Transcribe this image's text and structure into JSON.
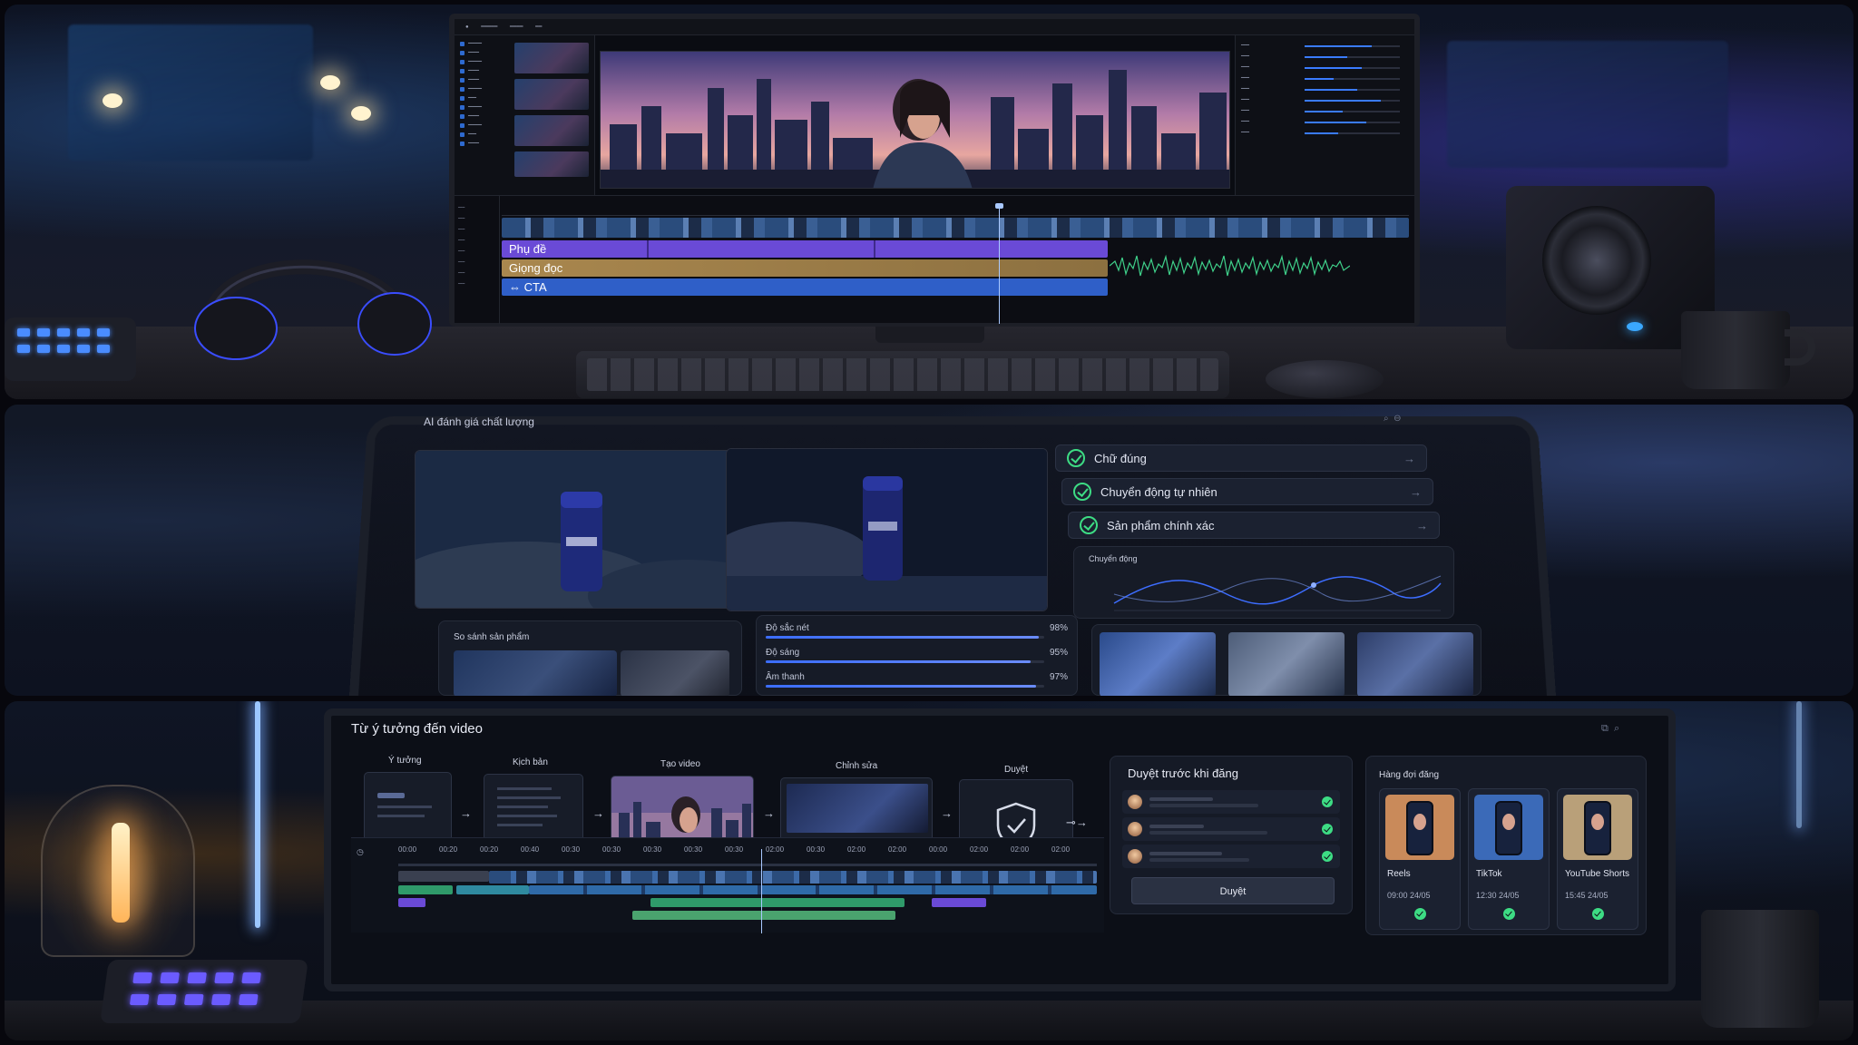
{
  "editor": {
    "tracks": {
      "subtitle": "Phụ đề",
      "voiceover": "Giọng đọc",
      "cta": "CTA"
    }
  },
  "quality": {
    "title": "AI đánh giá chất lượng",
    "checks": [
      {
        "label": "Chữ đúng",
        "status": "passed"
      },
      {
        "label": "Chuyển động tự nhiên",
        "status": "passed"
      },
      {
        "label": "Sản phẩm chính xác",
        "status": "passed"
      }
    ],
    "motion_chart_label": "Chuyển động",
    "compare_label": "So sánh sản phẩm",
    "metrics": [
      {
        "label": "Độ sắc nét",
        "value": "98%",
        "fraction": 0.98
      },
      {
        "label": "Độ sáng",
        "value": "95%",
        "fraction": 0.95
      },
      {
        "label": "Âm thanh",
        "value": "97%",
        "fraction": 0.97
      }
    ],
    "accent_color": "#3ddc84"
  },
  "workflow": {
    "title": "Từ ý tưởng đến video",
    "steps": [
      "Ý tưởng",
      "Kịch bản",
      "Tạo video",
      "Chỉnh sửa",
      "Duyệt"
    ],
    "ruler": [
      "00:00",
      "00:20",
      "00:20",
      "00:40",
      "00:30",
      "00:30",
      "00:30",
      "00:30",
      "00:30",
      "02:00",
      "00:30",
      "02:00",
      "02:00",
      "00:00",
      "02:00",
      "02:00",
      "02:00"
    ],
    "review": {
      "title": "Duyệt trước khi đăng",
      "approve_label": "Duyệt"
    },
    "queue": {
      "title": "Hàng đợi đăng",
      "items": [
        {
          "platform": "Reels",
          "time": "09:00 24/05"
        },
        {
          "platform": "TikTok",
          "time": "12:30 24/05"
        },
        {
          "platform": "YouTube Shorts",
          "time": "15:45 24/05"
        }
      ]
    }
  }
}
